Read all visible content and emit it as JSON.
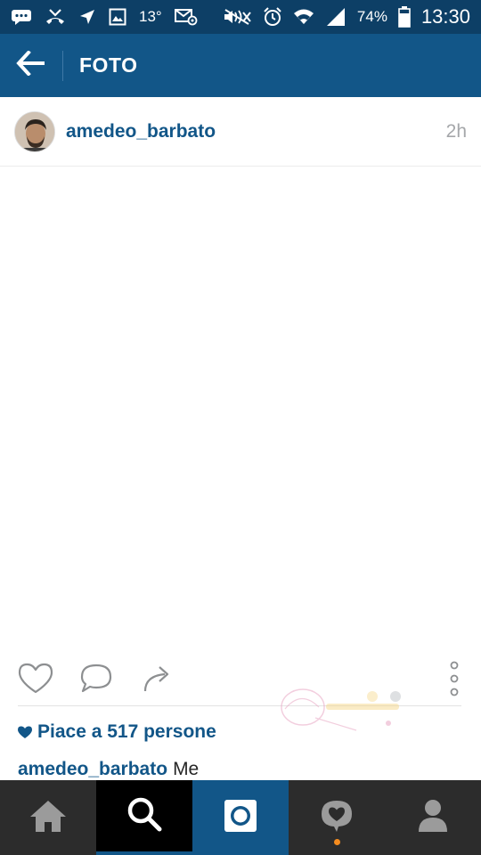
{
  "status_bar": {
    "temperature": "13°",
    "battery": "74%",
    "time": "13:30"
  },
  "app_bar": {
    "title": "FOTO"
  },
  "post": {
    "username": "amedeo_barbato",
    "time_ago": "2h",
    "likes": "Piace a 517 persone",
    "caption_user": "amedeo_barbato",
    "caption_text": "Me"
  },
  "colors": {
    "status_bar": "#0d3f66",
    "app_bar": "#125688",
    "accent": "#125688",
    "nav_bar": "#2c2c2c",
    "notification_dot": "#f58c1f"
  },
  "icons": {
    "status": [
      "chat-icon",
      "missed-call-icon",
      "navigation-icon",
      "image-icon",
      "email-icon",
      "mute-icon",
      "alarm-icon",
      "wifi-icon",
      "signal-icon",
      "battery-icon"
    ],
    "nav": [
      "home-icon",
      "search-icon",
      "camera-icon",
      "activity-icon",
      "profile-icon"
    ]
  }
}
